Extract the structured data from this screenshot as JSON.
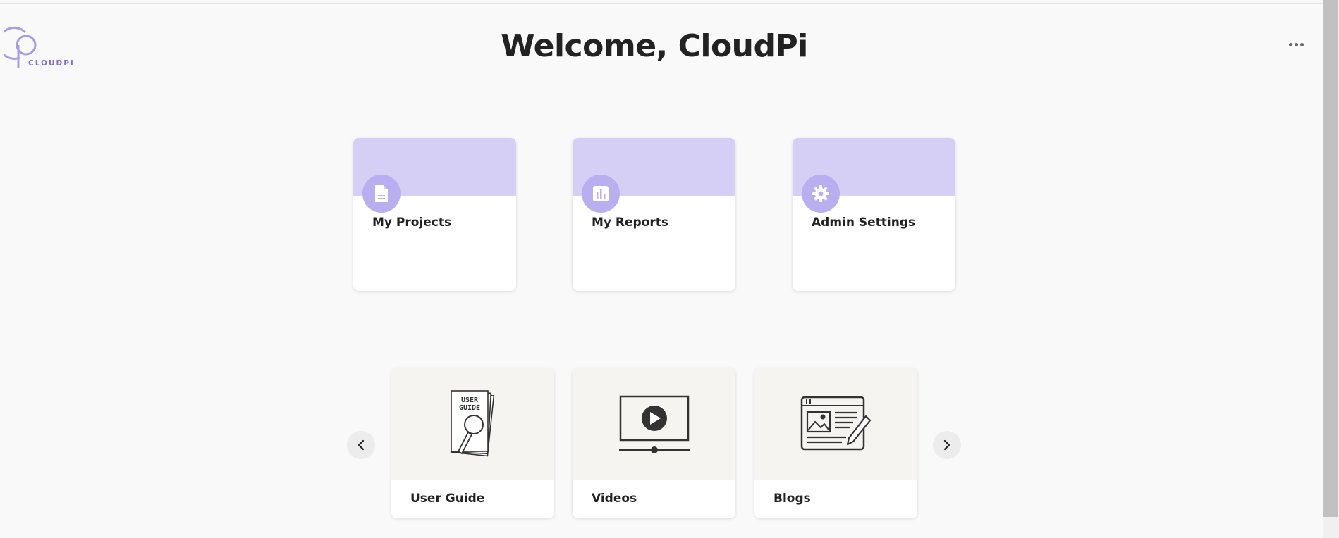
{
  "brand": {
    "logo_text": "CLOUDPI",
    "accent": "#7c6cdf"
  },
  "header": {
    "title": "Welcome, CloudPi",
    "menu_icon": "more-horizontal-icon"
  },
  "quick_links": [
    {
      "label": "My Projects",
      "icon": "document-icon"
    },
    {
      "label": "My Reports",
      "icon": "bar-chart-icon"
    },
    {
      "label": "Admin Settings",
      "icon": "gear-icon"
    }
  ],
  "resources": [
    {
      "label": "User Guide",
      "icon": "user-guide-illustration",
      "illustration_text": [
        "USER",
        "GUIDE"
      ]
    },
    {
      "label": "Videos",
      "icon": "video-player-illustration"
    },
    {
      "label": "Blogs",
      "icon": "blog-article-illustration"
    }
  ],
  "carousel": {
    "prev_icon": "chevron-left-icon",
    "next_icon": "chevron-right-icon"
  },
  "colors": {
    "card_band": "#d5cff5",
    "icon_circle": "#b9aeef",
    "background": "#f9f9f9"
  }
}
